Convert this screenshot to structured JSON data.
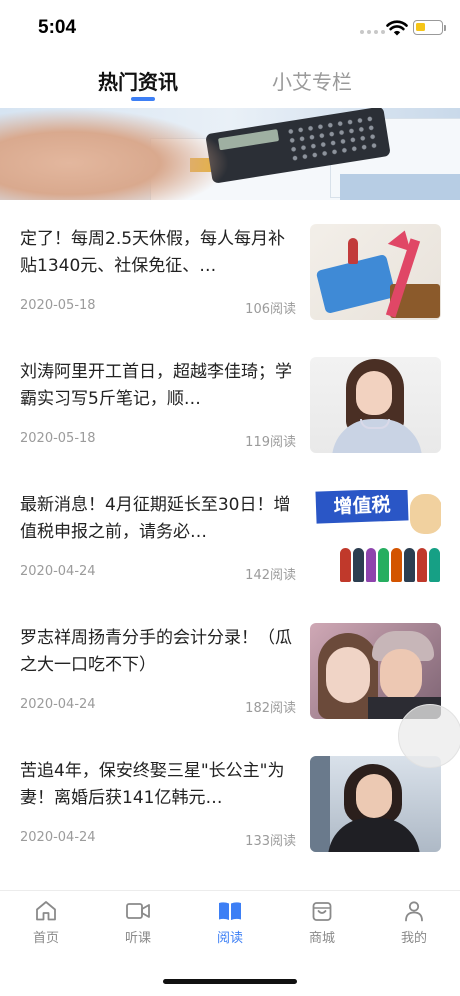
{
  "status_bar": {
    "time": "5:04"
  },
  "tabs": [
    {
      "label": "热门资讯",
      "active": true
    },
    {
      "label": "小艾专栏",
      "active": false
    }
  ],
  "colors": {
    "accent": "#3d7ff5",
    "muted_text": "#9b9b9b",
    "battery": "#f5c518"
  },
  "news": [
    {
      "title": "定了！每周2.5天休假，每人每月补贴1340元、社保免征、…",
      "date": "2020-05-18",
      "reads": "106阅读"
    },
    {
      "title": "刘涛阿里开工首日，超越李佳琦；学霸实习写5斤笔记，顺…",
      "date": "2020-05-18",
      "reads": "119阅读"
    },
    {
      "title": "最新消息！4月征期延长至30日！增值税申报之前，请务必…",
      "date": "2020-04-24",
      "reads": "142阅读"
    },
    {
      "title": "罗志祥周扬青分手的会计分录！（瓜之大一口吃不下）",
      "date": "2020-04-24",
      "reads": "182阅读"
    },
    {
      "title": "苦追4年，保安终娶三星\"长公主\"为妻！离婚后获141亿韩元…",
      "date": "2020-04-24",
      "reads": "133阅读"
    }
  ],
  "thumb_text": {
    "vat_label": "增值税"
  },
  "bottom_nav": [
    {
      "label": "首页",
      "icon": "home-icon",
      "active": false
    },
    {
      "label": "听课",
      "icon": "video-icon",
      "active": false
    },
    {
      "label": "阅读",
      "icon": "book-icon",
      "active": true
    },
    {
      "label": "商城",
      "icon": "shopping-bag-icon",
      "active": false
    },
    {
      "label": "我的",
      "icon": "person-icon",
      "active": false
    }
  ]
}
